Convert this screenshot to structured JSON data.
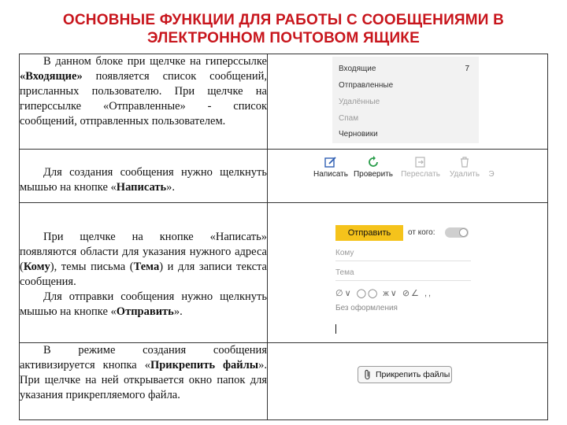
{
  "title": {
    "line1": "ОСНОВНЫЕ ФУНКЦИИ ДЛЯ РАБОТЫ С СООБЩЕНИЯМИ В",
    "line2": "ЭЛЕКТРОННОМ ПОЧТОВОМ ЯЩИКЕ"
  },
  "rows": {
    "r1": {
      "t1": "В данном блоке при щелчке на гиперссылке ",
      "b1": "«Входящие»",
      "t2": " появляется список сообщений, присланных пользователю. При щелчке на гиперссылке «Отправленные» - список сообщений, отправленных пользователем."
    },
    "r2": {
      "t1": "Для создания сообщения нужно щелкнуть мышью на кнопке «",
      "b1": "Написать",
      "t2": "»."
    },
    "r3": {
      "p1_t1": "При щелчке на кнопке «Написать» появляются области для указания нужного адреса (",
      "p1_b1": "Кому",
      "p1_t2": "), темы письма (",
      "p1_b2": "Тема",
      "p1_t3": ") и для записи текста сообщения.",
      "p2_t1": "Для отправки сообщения нужно щелкнуть мышью на кнопке «",
      "p2_b1": "Отправить",
      "p2_t2": "»."
    },
    "r4": {
      "t1": "В режиме создания сообщения активизируется кнопка «",
      "b1": "Прикрепить файлы",
      "t2": "». При щелчке на ней открывается окно папок для указания прикрепляемого файла."
    }
  },
  "mail": {
    "folders": {
      "inbox": "Входящие",
      "inbox_count": "7",
      "sent": "Отправленные",
      "deleted": "Удалённые",
      "spam": "Спам",
      "drafts": "Черновики"
    },
    "toolbar": {
      "write": "Написать",
      "check": "Проверить",
      "forward": "Переслать",
      "delete": "Удалить",
      "more": "Э"
    },
    "compose": {
      "send": "Отправить",
      "from": "от кого:",
      "to": "Кому",
      "subject": "Тема",
      "format_tools": "∅∨ ◯◯ ж∨ ⊘∠ ,,",
      "no_format": "Без оформления"
    },
    "attach": "Прикрепить файлы"
  },
  "colors": {
    "title": "#c8161d",
    "send_button": "#f5c31b",
    "write_icon": "#2f5fb3",
    "check_icon": "#2a9d4b"
  }
}
